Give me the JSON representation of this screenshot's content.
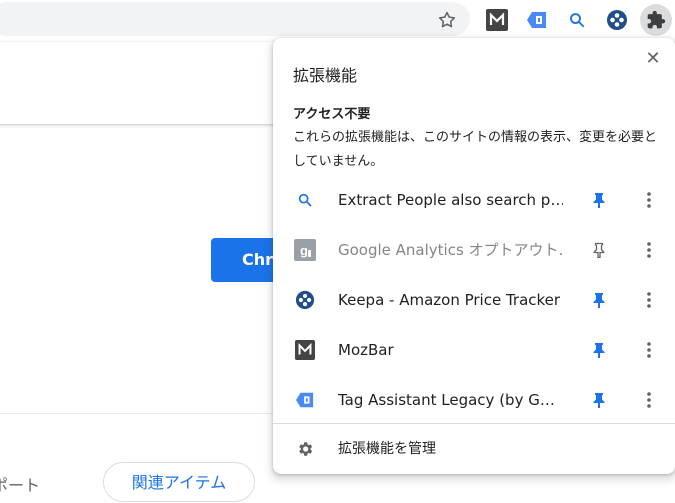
{
  "toolbar": {
    "icons": [
      "star-icon",
      "mozbar-icon",
      "tag-assistant-icon",
      "extract-people-search-icon",
      "keepa-icon",
      "extensions-puzzle-icon"
    ]
  },
  "page": {
    "primary_button": "Chr",
    "support_text": "ポート",
    "related_button": "関連アイテム"
  },
  "popup": {
    "title": "拡張機能",
    "close_label": "✕",
    "section_heading": "アクセス不要",
    "section_description": "これらの拡張機能は、このサイトの情報の表示、変更を必要としていません。",
    "extensions": [
      {
        "name": "Extract People also search p…",
        "icon": "search-icon",
        "pinned": true,
        "enabled": true
      },
      {
        "name": "Google Analytics オプトアウト…",
        "icon": "google-analytics-optout-icon",
        "pinned": false,
        "enabled": false
      },
      {
        "name": "Keepa - Amazon Price Tracker",
        "icon": "keepa-icon",
        "pinned": true,
        "enabled": true
      },
      {
        "name": "MozBar",
        "icon": "mozbar-icon",
        "pinned": true,
        "enabled": true
      },
      {
        "name": "Tag Assistant Legacy (by G…",
        "icon": "tag-assistant-icon",
        "pinned": true,
        "enabled": true
      }
    ],
    "manage_label": "拡張機能を管理"
  },
  "colors": {
    "accent": "#1a73e8",
    "pin_active": "#1a73e8",
    "icon_gray": "#5f6368"
  }
}
